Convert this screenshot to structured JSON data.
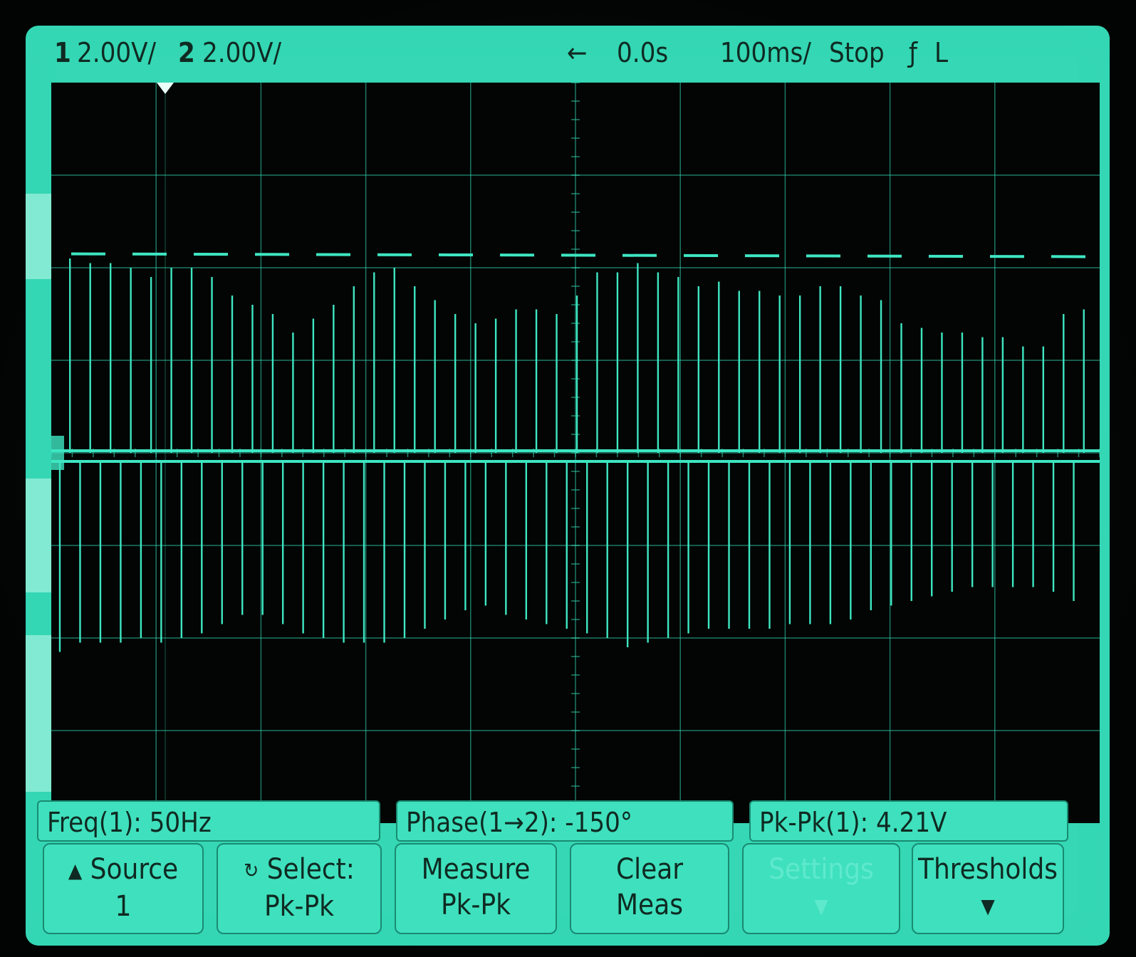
{
  "status": {
    "ch1_num": "1",
    "ch1_scale": "2.00V/",
    "ch2_num": "2",
    "ch2_scale": "2.00V/",
    "delay_arrow": "←",
    "delay": "0.0s",
    "timebase": "100ms/",
    "run_state": "Stop",
    "trigger_icon": "falling-edge-trigger-icon",
    "trigger_glyph": "ƒ",
    "trigger_source": "L"
  },
  "measurements": {
    "freq": "Freq(1): 50Hz",
    "phase": "Phase(1→2): -150°",
    "pkpk": "Pk-Pk(1): 4.21V"
  },
  "softkeys": {
    "source": {
      "line1": "Source",
      "line2": "1",
      "icon": "up-triangle-icon",
      "glyph": "▲"
    },
    "select": {
      "line1": "Select:",
      "line2": "Pk-Pk",
      "icon": "entry-knob-icon",
      "glyph": "↻"
    },
    "measure": {
      "line1": "Measure",
      "line2": "Pk-Pk"
    },
    "clear": {
      "line1": "Clear",
      "line2": "Meas"
    },
    "settings": {
      "line1": "Settings",
      "disabled": true
    },
    "thresholds": {
      "line1": "Thresholds",
      "icon": "down-arrow-icon",
      "glyph": "▼"
    }
  },
  "colors": {
    "phosphor": "#35d7b4",
    "trace": "#3ee6c2",
    "screen_bg": "#020504",
    "text": "#0f2a22"
  },
  "chart_data": {
    "type": "line",
    "title": "",
    "xlabel": "",
    "ylabel": "",
    "grid": true,
    "x_divisions": 10,
    "y_divisions": 8,
    "timebase_s_per_div": 0.1,
    "volts_per_div": 2.0,
    "series": [
      {
        "pulse_count": 51,
        "upper_peak_div": [
          2.1,
          2.05,
          2.05,
          2.0,
          1.9,
          2.0,
          2.0,
          1.9,
          1.7,
          1.6,
          1.5,
          1.3,
          1.45,
          1.6,
          1.8,
          1.95,
          2.0,
          1.8,
          1.65,
          1.5,
          1.4,
          1.45,
          1.55,
          1.55,
          1.5,
          1.7,
          1.95,
          1.95,
          2.05,
          1.95,
          1.9,
          1.8,
          1.85,
          1.75,
          1.75,
          1.7,
          1.7,
          1.8,
          1.8,
          1.7,
          1.65,
          1.4,
          1.35,
          1.3,
          1.3,
          1.25,
          1.25,
          1.15,
          1.15,
          1.5,
          1.55
        ],
        "lower_peak_div": [
          -2.15,
          -2.05,
          -2.05,
          -2.05,
          -2.0,
          -2.05,
          -2.0,
          -1.95,
          -1.85,
          -1.75,
          -1.75,
          -1.85,
          -1.95,
          -2.0,
          -2.05,
          -2.05,
          -2.05,
          -2.0,
          -1.9,
          -1.8,
          -1.7,
          -1.65,
          -1.75,
          -1.8,
          -1.85,
          -1.9,
          -1.95,
          -2.0,
          -2.1,
          -2.05,
          -2.0,
          -1.95,
          -1.9,
          -1.9,
          -1.9,
          -1.9,
          -1.85,
          -1.85,
          -1.85,
          -1.8,
          -1.7,
          -1.65,
          -1.6,
          -1.55,
          -1.5,
          -1.45,
          -1.45,
          -1.45,
          -1.45,
          -1.5,
          -1.6
        ]
      }
    ],
    "marker_level_div": 2.15,
    "center_div": 0.0
  }
}
